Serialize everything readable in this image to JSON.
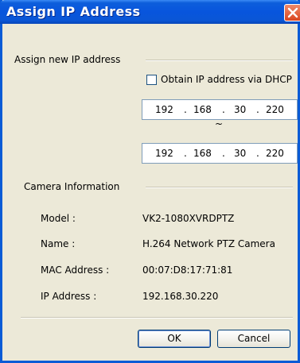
{
  "window": {
    "title": "Assign IP Address"
  },
  "assign": {
    "section_label": "Assign new IP address",
    "dhcp_label": "Obtain IP address via DHCP",
    "dhcp_checked": false,
    "start_ip": [
      "192",
      "168",
      "30",
      "220"
    ],
    "range_separator": "~",
    "end_ip": [
      "192",
      "168",
      "30",
      "220"
    ]
  },
  "camera": {
    "section_label": "Camera Information",
    "model_label": "Model :",
    "model_value": "VK2-1080XVRDPTZ",
    "name_label": "Name :",
    "name_value": "H.264 Network PTZ Camera",
    "mac_label": "MAC Address :",
    "mac_value": "00:07:D8:17:71:81",
    "ip_label": "IP Address :",
    "ip_value": "192.168.30.220"
  },
  "buttons": {
    "ok": "OK",
    "cancel": "Cancel"
  },
  "colors": {
    "titlebar": "#0A56D6",
    "dialog_bg": "#ECE9D8",
    "close_button": "#D9451F"
  }
}
